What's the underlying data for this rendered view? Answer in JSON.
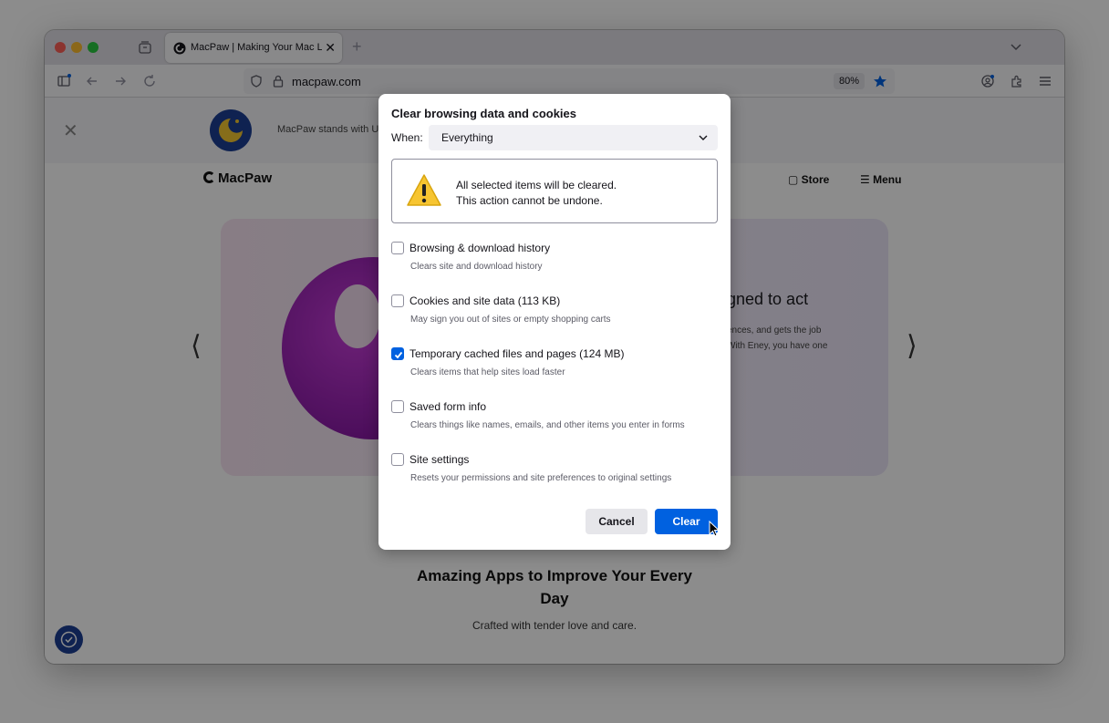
{
  "browser": {
    "tab_title": "MacPaw | Making Your Mac Life",
    "url": "macpaw.com",
    "zoom": "80%"
  },
  "page": {
    "banner_text": "MacPaw stands with U",
    "logo_text": "MacPaw",
    "nav_store": "Store",
    "nav_menu": "Menu",
    "hero_heading": "gned to act",
    "hero_body_line1": "ences, and gets the job",
    "hero_body_line2": "With Eney, you have one",
    "arrow_prev": "⟨",
    "arrow_next": "⟩",
    "heading_line1": "Amazing Apps to Improve Your Every",
    "heading_line2": "Day",
    "subheading": "Crafted with tender love and care."
  },
  "dialog": {
    "title": "Clear browsing data and cookies",
    "when_label": "When:",
    "when_value": "Everything",
    "warning_line1": "All selected items will be cleared.",
    "warning_line2": "This action cannot be undone.",
    "options": [
      {
        "label": "Browsing & download history",
        "description": "Clears site and download history",
        "checked": false
      },
      {
        "label": "Cookies and site data (113 KB)",
        "description": "May sign you out of sites or empty shopping carts",
        "checked": false
      },
      {
        "label": "Temporary cached files and pages (124 MB)",
        "description": "Clears items that help sites load faster",
        "checked": true
      },
      {
        "label": "Saved form info",
        "description": "Clears things like names, emails, and other items you enter in forms",
        "checked": false
      },
      {
        "label": "Site settings",
        "description": "Resets your permissions and site preferences to original settings",
        "checked": false
      }
    ],
    "cancel_label": "Cancel",
    "clear_label": "Clear"
  },
  "colors": {
    "accent": "#0061e0",
    "brand_blue": "#1c3f94"
  }
}
